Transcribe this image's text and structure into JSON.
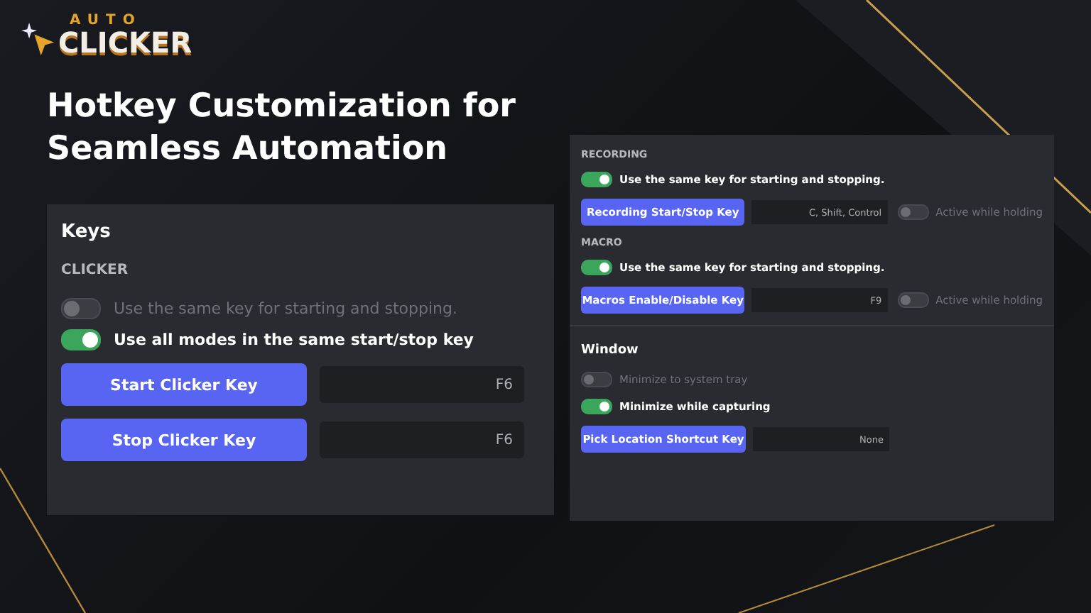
{
  "logo": {
    "line1": "AUTO",
    "line2": "CLICKER"
  },
  "headline": [
    "Hotkey Customization for",
    "Seamless Automation"
  ],
  "keys_panel": {
    "title": "Keys",
    "section": "CLICKER",
    "toggles": [
      {
        "label": "Use the same key for starting and stopping.",
        "on": false
      },
      {
        "label": "Use all modes in the same start/stop key",
        "on": true
      }
    ],
    "keys": [
      {
        "label": "Start Clicker Key",
        "value": "F6"
      },
      {
        "label": "Stop Clicker Key",
        "value": "F6"
      }
    ]
  },
  "settings_panel": {
    "sections": [
      {
        "kind": "caps",
        "title": "RECORDING",
        "toggles": [
          {
            "label": "Use the same key for starting and stopping.",
            "on": true
          }
        ],
        "keys": [
          {
            "label": "Recording Start/Stop Key",
            "value": "C, Shift, Control",
            "hold": {
              "label": "Active while holding",
              "on": false
            }
          }
        ]
      },
      {
        "kind": "caps",
        "title": "MACRO",
        "toggles": [
          {
            "label": "Use the same key for starting and stopping.",
            "on": true
          }
        ],
        "keys": [
          {
            "label": "Macros Enable/Disable Key",
            "value": "F9",
            "hold": {
              "label": "Active while holding",
              "on": false
            }
          }
        ]
      },
      {
        "kind": "heading",
        "title": "Window",
        "toggles": [
          {
            "label": "Minimize to system tray",
            "on": false
          },
          {
            "label": "Minimize while capturing",
            "on": true
          }
        ],
        "keys": [
          {
            "label": "Pick Location Shortcut Key",
            "value": "None"
          }
        ]
      }
    ]
  }
}
